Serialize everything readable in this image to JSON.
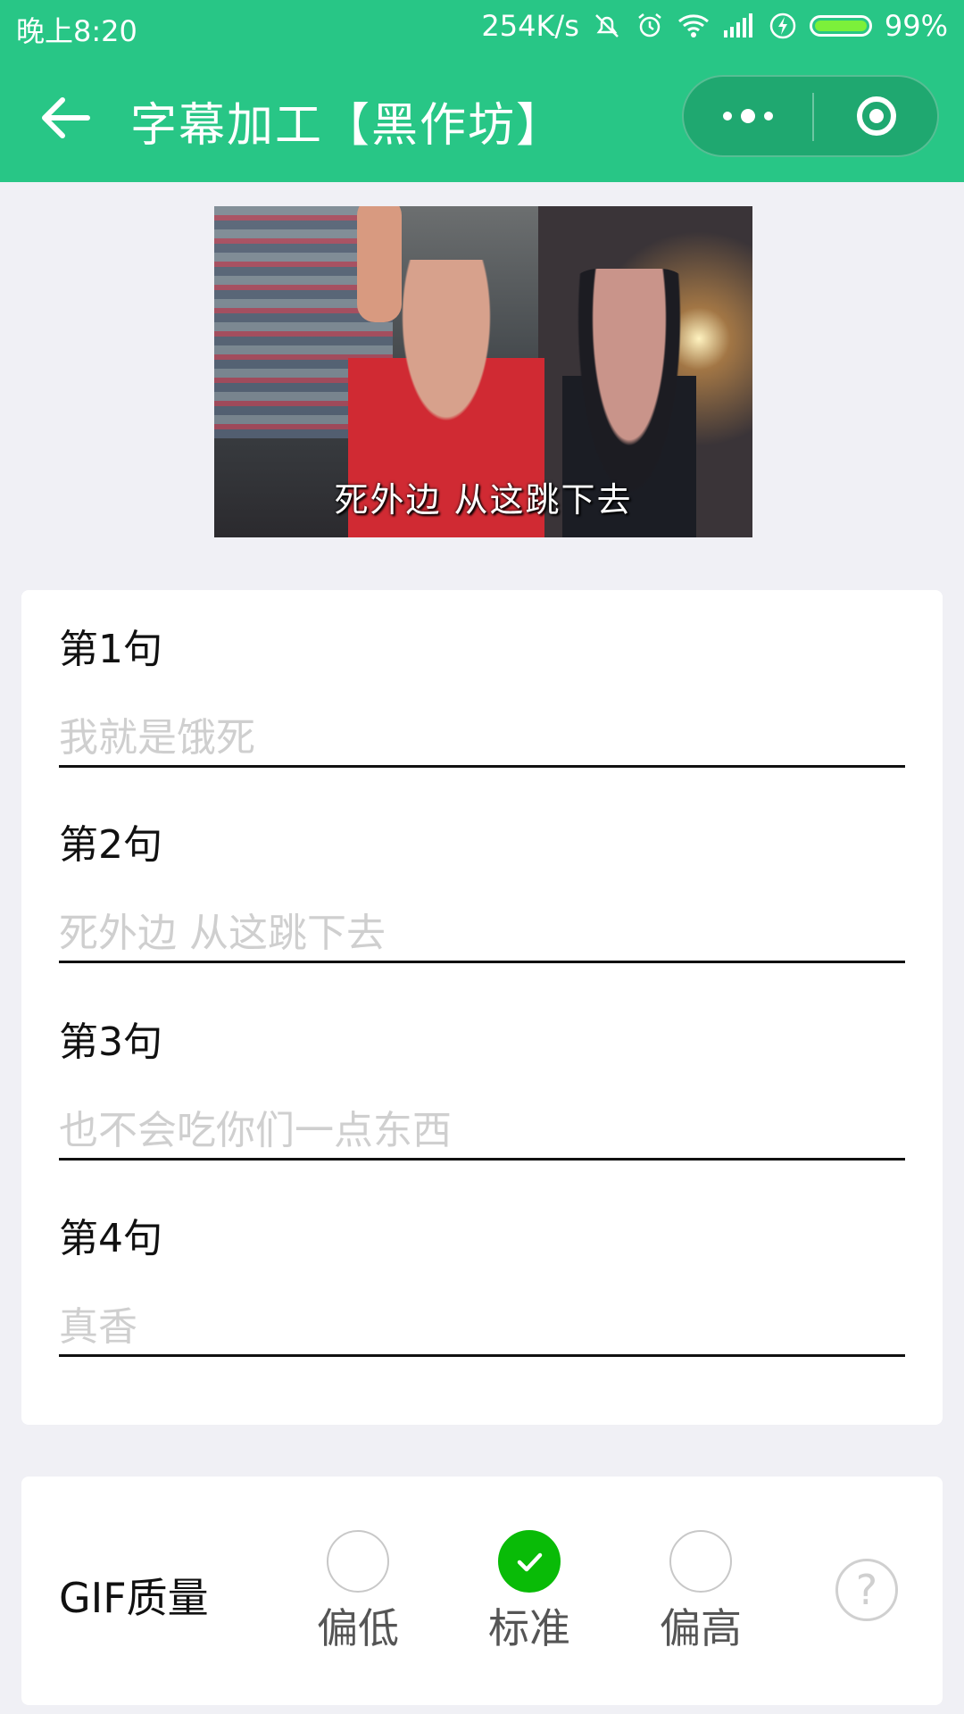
{
  "status_bar": {
    "time": "晚上8:20",
    "net_speed": "254K/s",
    "battery": "99%",
    "icons": [
      "mute-icon",
      "alarm-icon",
      "wifi-icon",
      "signal-icon",
      "charging-icon",
      "battery-icon"
    ]
  },
  "nav": {
    "title": "字幕加工【黑作坊】",
    "back_icon": "back-arrow-icon",
    "more_icon": "more-dots-icon",
    "close_icon": "target-close-icon"
  },
  "preview": {
    "caption": "死外边 从这跳下去"
  },
  "sentences": [
    {
      "label": "第1句",
      "placeholder": "我就是饿死",
      "value": ""
    },
    {
      "label": "第2句",
      "placeholder": "死外边 从这跳下去",
      "value": ""
    },
    {
      "label": "第3句",
      "placeholder": "也不会吃你们一点东西",
      "value": ""
    },
    {
      "label": "第4句",
      "placeholder": "真香",
      "value": ""
    }
  ],
  "quality": {
    "label": "GIF质量",
    "options": [
      {
        "label": "偏低",
        "checked": false
      },
      {
        "label": "标准",
        "checked": true
      },
      {
        "label": "偏高",
        "checked": false
      }
    ],
    "help": "?",
    "accent": "#09bb07"
  },
  "colors": {
    "theme": "#28c686",
    "background": "#f0f0f5"
  }
}
